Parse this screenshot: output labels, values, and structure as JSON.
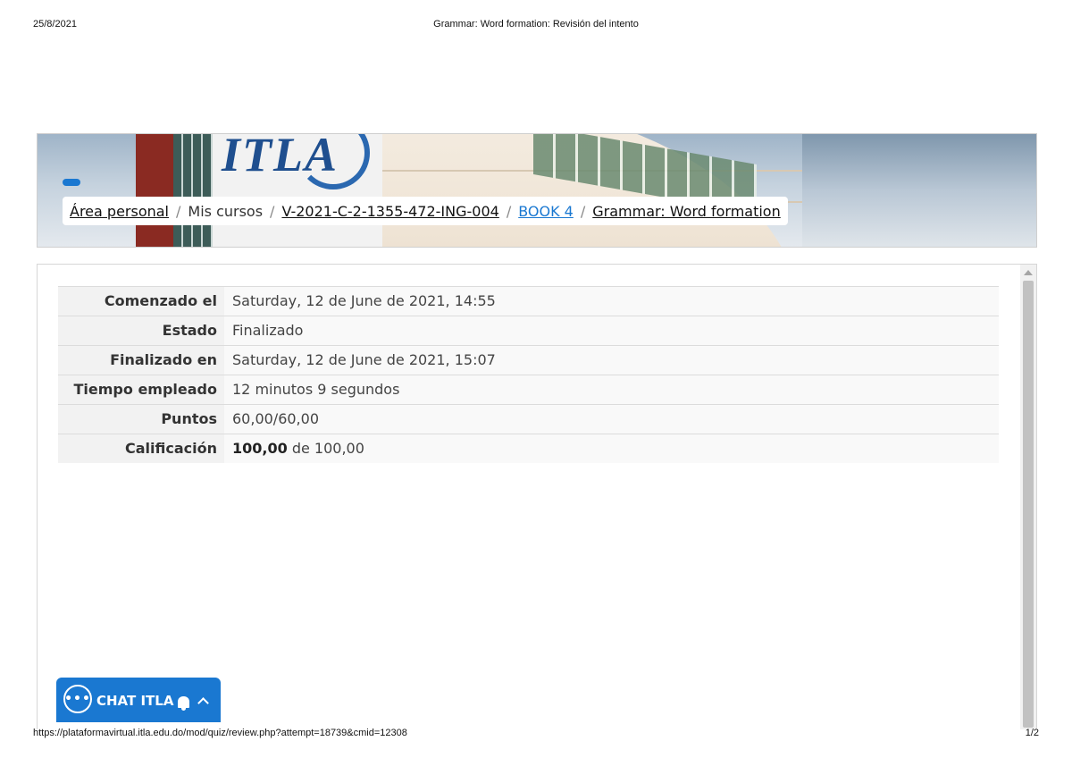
{
  "print_header": {
    "date": "25/8/2021",
    "title": "Grammar: Word formation: Revisión del intento"
  },
  "print_footer": {
    "url": "https://plataformavirtual.itla.edu.do/mod/quiz/review.php?attempt=18739&cmid=12308",
    "page": "1/2"
  },
  "banner": {
    "logo_text": "ITLA"
  },
  "breadcrumb": {
    "items": [
      {
        "label": "Área personal"
      },
      {
        "label": "Mis cursos"
      },
      {
        "label": "V-2021-C-2-1355-472-ING-004"
      },
      {
        "label": "BOOK 4"
      },
      {
        "label": "Grammar: Word formation"
      }
    ],
    "separator": "/"
  },
  "summary": {
    "rows": [
      {
        "label": "Comenzado el",
        "value": "Saturday, 12 de June de 2021, 14:55"
      },
      {
        "label": "Estado",
        "value": "Finalizado"
      },
      {
        "label": "Finalizado en",
        "value": "Saturday, 12 de June de 2021, 15:07"
      },
      {
        "label": "Tiempo empleado",
        "value": "12 minutos 9 segundos"
      },
      {
        "label": "Puntos",
        "value": "60,00/60,00"
      },
      {
        "label": "Calificación",
        "value_bold": "100,00",
        "value_rest": " de 100,00"
      }
    ]
  },
  "chat": {
    "label": "CHAT ITLA",
    "icon_glyph": "•••"
  },
  "colors": {
    "accent": "#1a78d1",
    "link_active": "#1a78d1"
  }
}
